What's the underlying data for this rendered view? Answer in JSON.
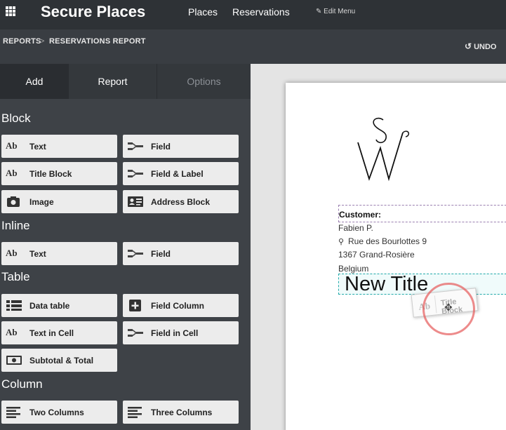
{
  "app": {
    "title": "Secure Places"
  },
  "nav": {
    "places": "Places",
    "reservations": "Reservations",
    "edit_menu": "Edit Menu"
  },
  "breadcrumb": {
    "reports": "REPORTS",
    "separator": ">",
    "current": "RESERVATIONS REPORT"
  },
  "undo": {
    "label": "UNDO"
  },
  "tabs": {
    "add": "Add",
    "report": "Report",
    "options": "Options"
  },
  "sections": {
    "block": "Block",
    "inline": "Inline",
    "table": "Table",
    "column": "Column"
  },
  "buttons": {
    "text": "Text",
    "field": "Field",
    "title_block": "Title Block",
    "field_label": "Field & Label",
    "image": "Image",
    "address_block": "Address Block",
    "inline_text": "Text",
    "inline_field": "Field",
    "data_table": "Data table",
    "field_column": "Field Column",
    "text_in_cell": "Text in Cell",
    "field_in_cell": "Field in Cell",
    "subtotal_total": "Subtotal & Total",
    "two_columns": "Two Columns",
    "three_columns": "Three Columns",
    "ab_glyph": "Ab"
  },
  "report": {
    "customer_label": "Customer:",
    "name": "Fabien P.",
    "street": "Rue des Bourlottes 9",
    "city": "1367 Grand-Rosière",
    "country": "Belgium",
    "new_title": "New Title",
    "drag_label": "Title Block",
    "logo_letters": "SW"
  },
  "colors": {
    "accent_drop": "#22aaaa",
    "cursor_ring": "#e65a5a",
    "customer_outline": "#9a7fb0"
  }
}
